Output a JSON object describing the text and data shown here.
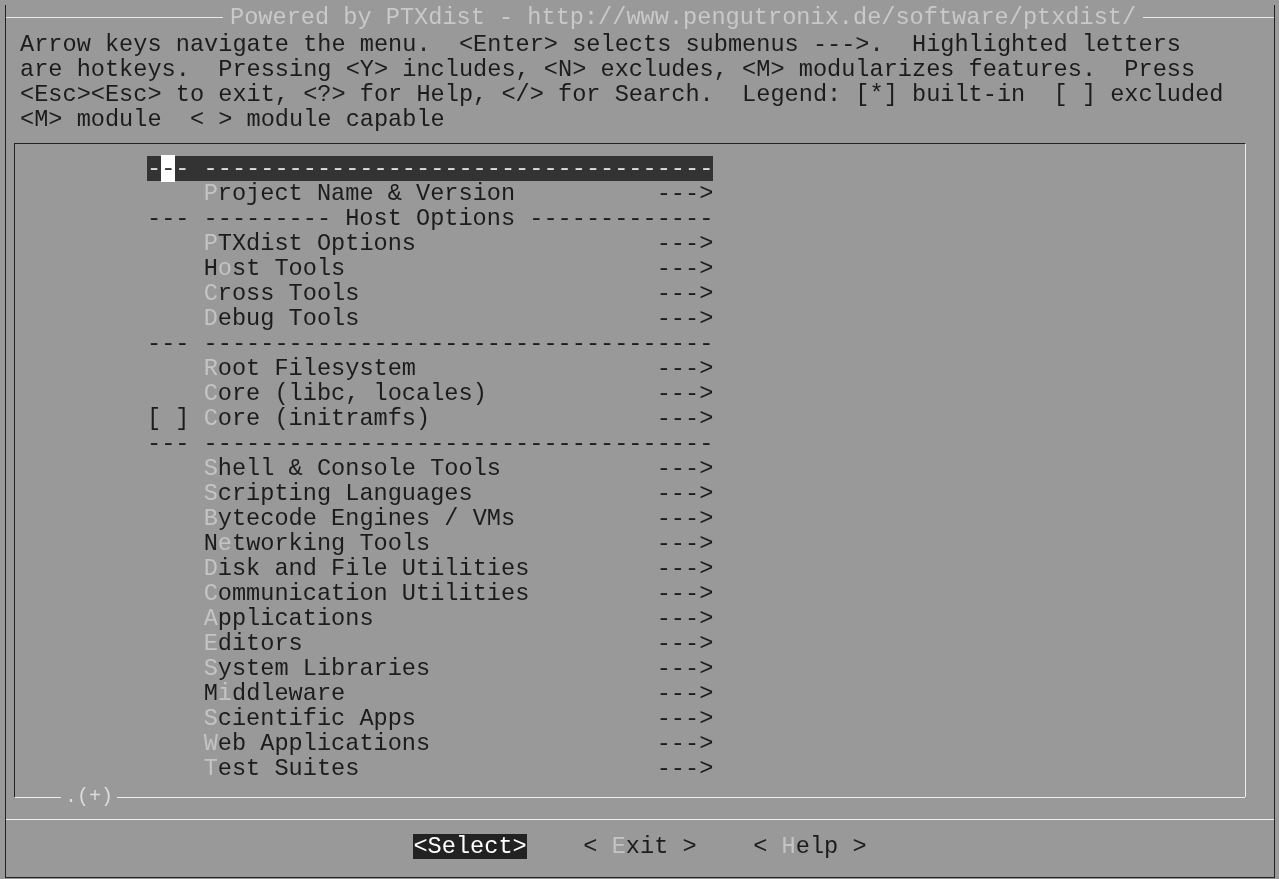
{
  "window": {
    "title": "Powered by PTXdist - http://www.pengutronix.de/software/ptxdist/"
  },
  "help_lines": [
    "Arrow keys navigate the menu.  <Enter> selects submenus --->.  Highlighted letters",
    "are hotkeys.  Pressing <Y> includes, <N> excludes, <M> modularizes features.  Press",
    "<Esc><Esc> to exit, <?> for Help, </> for Search.  Legend: [*] built-in  [ ] excluded",
    "<M> module  < > module capable"
  ],
  "menu": {
    "rows": [
      {
        "kind": "separator",
        "prefix": "---",
        "text": "------------------------------------",
        "selected": true
      },
      {
        "kind": "menu",
        "before": "",
        "hotkey": "P",
        "after": "roject Name & Version",
        "arrow": "--->",
        "selected": false
      },
      {
        "kind": "separator",
        "prefix": "---",
        "text": "--------- Host Options -------------",
        "selected": false
      },
      {
        "kind": "menu",
        "before": "",
        "hotkey": "P",
        "after": "TXdist Options",
        "arrow": "--->",
        "selected": false
      },
      {
        "kind": "menu",
        "before": "H",
        "hotkey": "o",
        "after": "st Tools",
        "arrow": "--->",
        "selected": false
      },
      {
        "kind": "menu",
        "before": "",
        "hotkey": "C",
        "after": "ross Tools",
        "arrow": "--->",
        "selected": false
      },
      {
        "kind": "menu",
        "before": "",
        "hotkey": "D",
        "after": "ebug Tools",
        "arrow": "--->",
        "selected": false
      },
      {
        "kind": "separator",
        "prefix": "---",
        "text": "------------------------------------",
        "selected": false
      },
      {
        "kind": "menu",
        "before": "",
        "hotkey": "R",
        "after": "oot Filesystem",
        "arrow": "--->",
        "selected": false
      },
      {
        "kind": "menu",
        "before": "",
        "hotkey": "C",
        "after": "ore (libc, locales)",
        "arrow": "--->",
        "selected": false
      },
      {
        "kind": "menu",
        "prefix": "[ ]",
        "before": "",
        "hotkey": "C",
        "after": "ore (initramfs)",
        "arrow": "--->",
        "selected": false
      },
      {
        "kind": "separator",
        "prefix": "---",
        "text": "------------------------------------",
        "selected": false
      },
      {
        "kind": "menu",
        "before": "",
        "hotkey": "S",
        "after": "hell & Console Tools",
        "arrow": "--->",
        "selected": false
      },
      {
        "kind": "menu",
        "before": "",
        "hotkey": "S",
        "after": "cripting Languages",
        "arrow": "--->",
        "selected": false
      },
      {
        "kind": "menu",
        "before": "",
        "hotkey": "B",
        "after": "ytecode Engines / VMs",
        "arrow": "--->",
        "selected": false
      },
      {
        "kind": "menu",
        "before": "N",
        "hotkey": "e",
        "after": "tworking Tools",
        "arrow": "--->",
        "selected": false
      },
      {
        "kind": "menu",
        "before": "",
        "hotkey": "D",
        "after": "isk and File Utilities",
        "arrow": "--->",
        "selected": false
      },
      {
        "kind": "menu",
        "before": "",
        "hotkey": "C",
        "after": "ommunication Utilities",
        "arrow": "--->",
        "selected": false
      },
      {
        "kind": "menu",
        "before": "",
        "hotkey": "A",
        "after": "pplications",
        "arrow": "--->",
        "selected": false
      },
      {
        "kind": "menu",
        "before": "",
        "hotkey": "E",
        "after": "ditors",
        "arrow": "--->",
        "selected": false
      },
      {
        "kind": "menu",
        "before": "",
        "hotkey": "S",
        "after": "ystem Libraries",
        "arrow": "--->",
        "selected": false
      },
      {
        "kind": "menu",
        "before": "M",
        "hotkey": "i",
        "after": "ddleware",
        "arrow": "--->",
        "selected": false
      },
      {
        "kind": "menu",
        "before": "",
        "hotkey": "S",
        "after": "cientific Apps",
        "arrow": "--->",
        "selected": false
      },
      {
        "kind": "menu",
        "before": "",
        "hotkey": "W",
        "after": "eb Applications",
        "arrow": "--->",
        "selected": false
      },
      {
        "kind": "menu",
        "before": "",
        "hotkey": "T",
        "after": "est Suites",
        "arrow": "--->",
        "selected": false
      }
    ],
    "more_indicator": ".(+)"
  },
  "buttons": [
    {
      "before": "<",
      "hotkey": "S",
      "after": "elect>",
      "selected": true
    },
    {
      "before": "< ",
      "hotkey": "E",
      "after": "xit >",
      "selected": false
    },
    {
      "before": "< ",
      "hotkey": "H",
      "after": "elp >",
      "selected": false
    }
  ]
}
